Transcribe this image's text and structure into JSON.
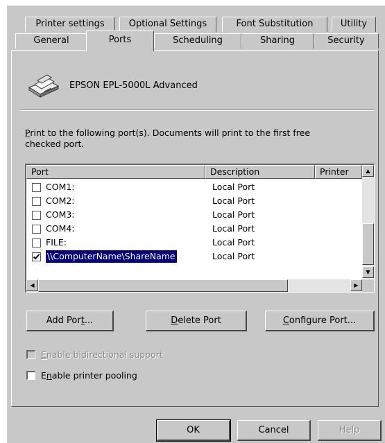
{
  "tabs_back": [
    "Printer settings",
    "Optional Settings",
    "Font Substitution",
    "Utility"
  ],
  "tabs_front": [
    "General",
    "Ports",
    "Scheduling",
    "Sharing",
    "Security"
  ],
  "selected_tab": "Ports",
  "printer_name": "EPSON EPL-5000L Advanced",
  "instructions": {
    "accel": "P",
    "rest": "rint to the following port(s).  Documents will print to the first free checked port."
  },
  "port_list": {
    "columns": [
      "Port",
      "Description",
      "Printer"
    ],
    "rows": [
      {
        "port": "COM1:",
        "description": "Local Port",
        "checked": false,
        "selected": false
      },
      {
        "port": "COM2:",
        "description": "Local Port",
        "checked": false,
        "selected": false
      },
      {
        "port": "COM3:",
        "description": "Local Port",
        "checked": false,
        "selected": false
      },
      {
        "port": "COM4:",
        "description": "Local Port",
        "checked": false,
        "selected": false
      },
      {
        "port": "FILE:",
        "description": "Local Port",
        "checked": false,
        "selected": false
      },
      {
        "port": "\\\\ComputerName\\ShareName",
        "description": "Local Port",
        "checked": true,
        "selected": true
      }
    ]
  },
  "buttons": {
    "add_port": {
      "before": "Add Por",
      "accel": "t",
      "after": "..."
    },
    "delete_port": {
      "before": "",
      "accel": "D",
      "after": "elete Port"
    },
    "configure_port": {
      "before": "",
      "accel": "C",
      "after": "onfigure Port..."
    }
  },
  "bidi": {
    "before": "",
    "accel": "E",
    "after": "nable bidirectional support",
    "enabled": false
  },
  "pooling": {
    "before": "E",
    "accel": "n",
    "after": "able printer pooling",
    "checked": false
  },
  "footer": {
    "ok": "OK",
    "cancel": "Cancel",
    "help": "Help"
  },
  "colors": {
    "face": "#c8c8c8",
    "selection": "#000080",
    "disabled_text": "#8a8a8a"
  }
}
